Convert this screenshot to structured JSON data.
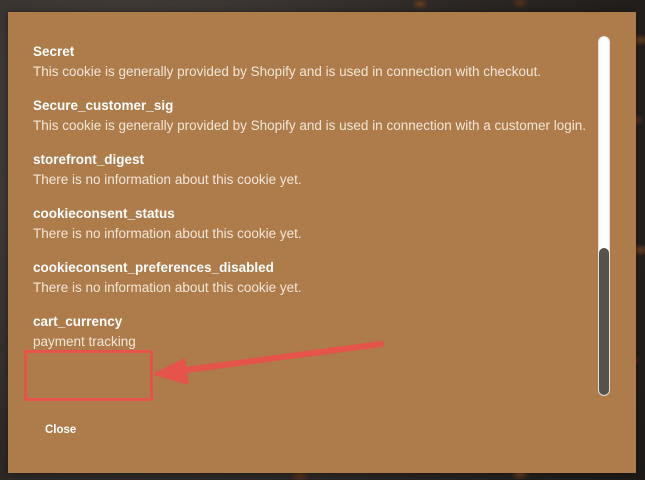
{
  "cookies": [
    {
      "name": "Secret",
      "description": "This cookie is generally provided by Shopify and is used in connection with checkout."
    },
    {
      "name": "Secure_customer_sig",
      "description": "This cookie is generally provided by Shopify and is used in connection with a customer login."
    },
    {
      "name": "storefront_digest",
      "description": "There is no information about this cookie yet."
    },
    {
      "name": "cookieconsent_status",
      "description": "There is no information about this cookie yet."
    },
    {
      "name": "cookieconsent_preferences_disabled",
      "description": "There is no information about this cookie yet."
    },
    {
      "name": "cart_currency",
      "description": "payment tracking"
    }
  ],
  "close_label": "Close",
  "colors": {
    "modal_bg": "#ae7b4a",
    "annotation_red": "#e5534b",
    "scroll_thumb": "#57514c"
  }
}
